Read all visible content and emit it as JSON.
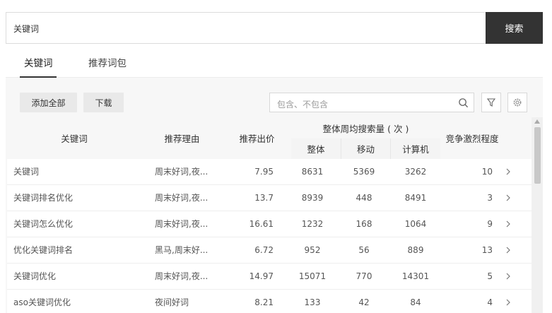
{
  "search": {
    "value": "关键词",
    "button_label": "搜索"
  },
  "tabs": [
    {
      "label": "关键词",
      "active": true
    },
    {
      "label": "推荐词包",
      "active": false
    }
  ],
  "toolbar": {
    "add_all_label": "添加全部",
    "download_label": "下载",
    "filter_placeholder": "包含、不包含"
  },
  "icons": {
    "search": "search-icon",
    "filter": "filter-icon",
    "settings": "gear-icon",
    "row_action": "chevron-right-icon",
    "scroll_up": "triangle-up-icon"
  },
  "table": {
    "headers": {
      "keyword": "关键词",
      "reason": "推荐理由",
      "bid": "推荐出价",
      "weekly_search_group": "整体周均搜索量 ( 次 )",
      "overall": "整体",
      "mobile": "移动",
      "pc": "计算机",
      "competition": "竞争激烈程度"
    },
    "rows": [
      {
        "keyword": "关键词",
        "reason": "周末好词,夜...",
        "bid": "7.95",
        "overall": "8631",
        "mobile": "5369",
        "pc": "3262",
        "competition": "10"
      },
      {
        "keyword": "关键词排名优化",
        "reason": "周末好词,夜...",
        "bid": "13.7",
        "overall": "8939",
        "mobile": "448",
        "pc": "8491",
        "competition": "3"
      },
      {
        "keyword": "关键词怎么优化",
        "reason": "周末好词,夜...",
        "bid": "16.61",
        "overall": "1232",
        "mobile": "168",
        "pc": "1064",
        "competition": "9"
      },
      {
        "keyword": "优化关键词排名",
        "reason": "黑马,周末好...",
        "bid": "6.72",
        "overall": "952",
        "mobile": "56",
        "pc": "889",
        "competition": "13"
      },
      {
        "keyword": "关键词优化",
        "reason": "周末好词,夜...",
        "bid": "14.97",
        "overall": "15071",
        "mobile": "770",
        "pc": "14301",
        "competition": "5"
      },
      {
        "keyword": "aso关键词优化",
        "reason": "夜间好词",
        "bid": "8.21",
        "overall": "133",
        "mobile": "42",
        "pc": "84",
        "competition": "4"
      }
    ]
  },
  "colors": {
    "search_button_bg": "#333333",
    "panel_bg": "#f7f7f7",
    "header_bg": "#f4f4f4"
  }
}
